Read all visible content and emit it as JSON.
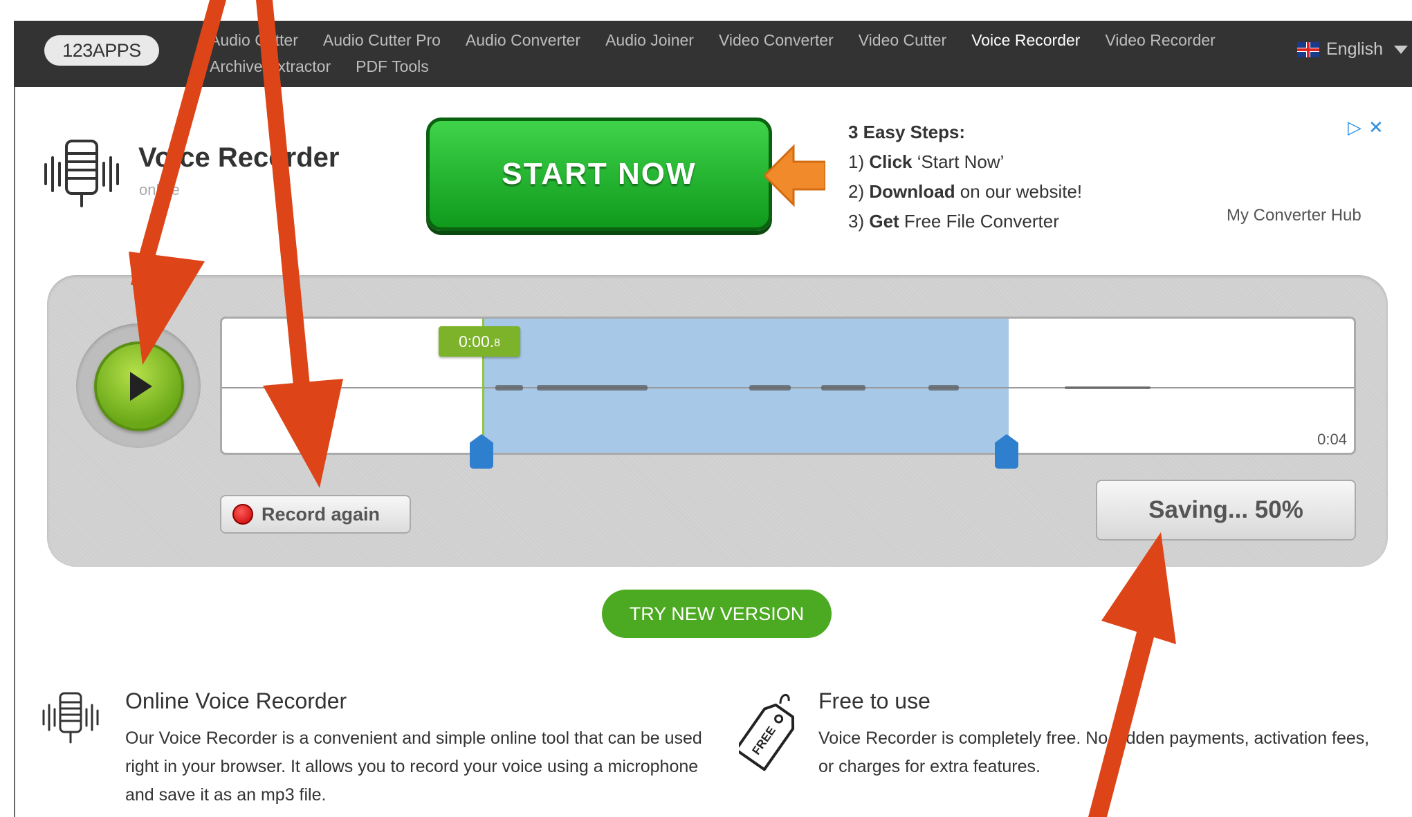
{
  "nav": {
    "logo": "123APPS",
    "links": [
      "Audio Cutter",
      "Audio Cutter Pro",
      "Audio Converter",
      "Audio Joiner",
      "Video Converter",
      "Video Cutter",
      "Voice Recorder",
      "Video Recorder",
      "Archive Extractor",
      "PDF Tools"
    ],
    "active_link": "Voice Recorder",
    "language": "English"
  },
  "header": {
    "title": "Voice Recorder",
    "subtitle": "online"
  },
  "ad": {
    "button_label": "START NOW",
    "steps_heading": "3 Easy Steps:",
    "step1_num": "1)",
    "step1_bold": "Click",
    "step1_rest": " ‘Start Now’",
    "step2_num": "2)",
    "step2_bold": "Download",
    "step2_rest": " on our website!",
    "step3_num": "3)",
    "step3_bold": "Get",
    "step3_rest": " Free File Converter",
    "brand": "My Converter Hub",
    "choices_icon": "adchoices-icon",
    "close_icon": "close-icon"
  },
  "player": {
    "position_label": "0:00.",
    "position_sub": "8",
    "end_time": "0:04",
    "record_again_label": "Record again",
    "save_label": "Saving... 50%",
    "save_progress": 0.5
  },
  "try_new_version": "TRY NEW VERSION",
  "features": [
    {
      "title": "Online Voice Recorder",
      "text": "Our Voice Recorder is a convenient and simple online tool that can be used right in your browser. It allows you to record your voice using a microphone and save it as an mp3 file.",
      "icon": "microphone-icon"
    },
    {
      "title": "Free to use",
      "text": "Voice Recorder is completely free. No hidden payments, activation fees, or charges for extra features.",
      "icon": "free-tag-icon"
    }
  ],
  "colors": {
    "nav_bg": "#333333",
    "accent_green": "#4caa22",
    "selection_blue": "#a7c8e6",
    "annotation_arrow": "#dd4418"
  }
}
